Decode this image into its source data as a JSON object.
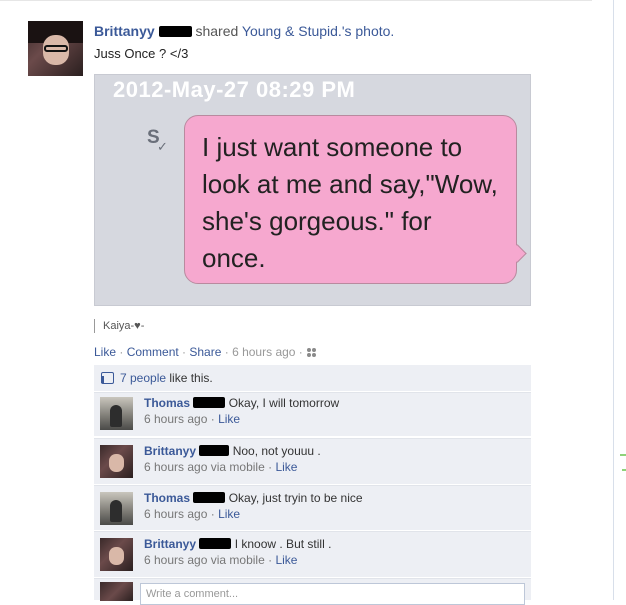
{
  "post": {
    "author": "Brittanyy",
    "shared_text": "shared",
    "page_name": "Young & Stupid.",
    "page_suffix": "'s photo.",
    "status": "Juss Once ? </3",
    "photo": {
      "timestamp": "2012-May-27 08:29 PM",
      "sender_initial": "S",
      "check": "✓",
      "message": "I just want someone to look at me and say,\"Wow, she's gorgeous.\" for once."
    },
    "via": "Kaiya-♥-",
    "actions": {
      "like": "Like",
      "comment": "Comment",
      "share": "Share",
      "time": "6 hours ago",
      "audience_icon": "friends-icon"
    },
    "likes": {
      "count_text": "7 people",
      "suffix": " like this.",
      "icon": "thumbs-up-icon"
    }
  },
  "comments": [
    {
      "name": "Thomas",
      "text": "Okay, I will tomorrow",
      "time": "6 hours ago",
      "via": "",
      "like": "Like"
    },
    {
      "name": "Brittanyy",
      "text": "Noo, not youuu .",
      "time": "6 hours ago",
      "via": "via mobile",
      "like": "Like"
    },
    {
      "name": "Thomas",
      "text": "Okay, just tryin to be nice",
      "time": "6 hours ago",
      "via": "",
      "like": "Like"
    },
    {
      "name": "Brittanyy",
      "text": "I knoow . But still .",
      "time": "6 hours ago",
      "via": "via mobile",
      "like": "Like"
    }
  ],
  "write_comment": {
    "placeholder": "Write a comment..."
  },
  "colors": {
    "link": "#3b5998",
    "panel": "#edeff4",
    "bubble": "#f6a8cf"
  }
}
